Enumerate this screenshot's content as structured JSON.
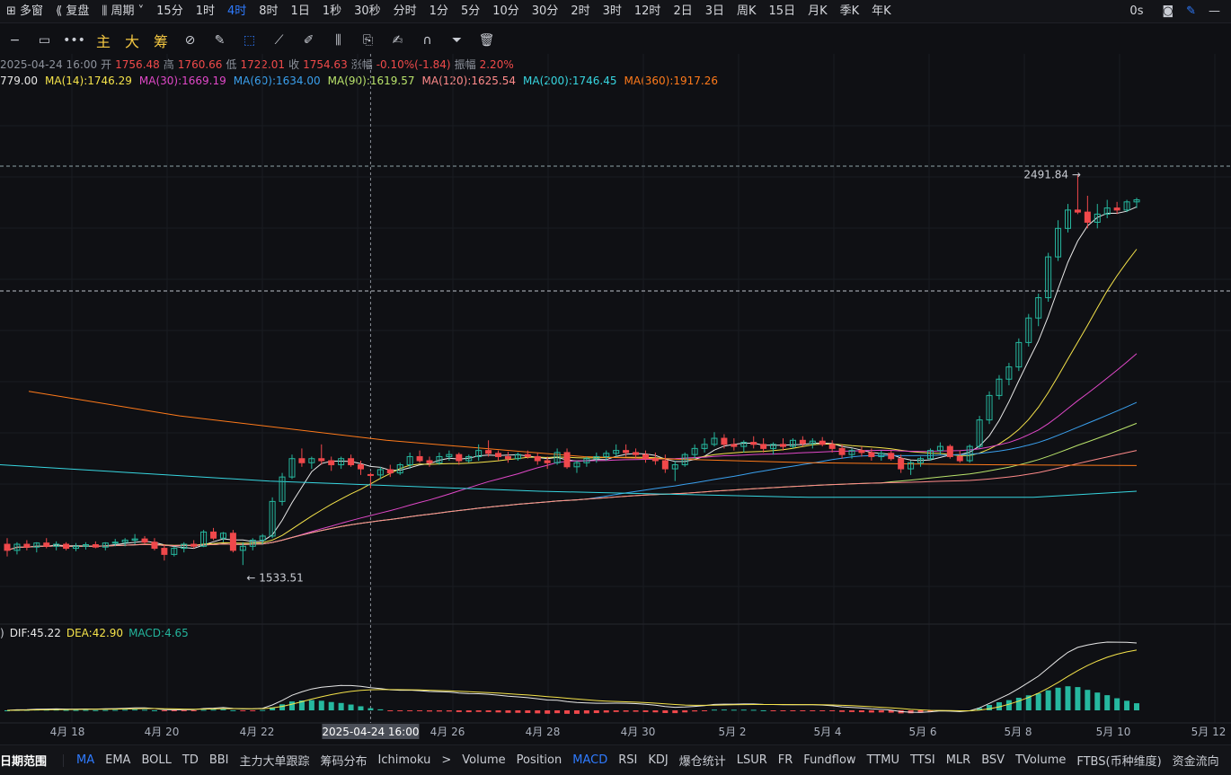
{
  "topbar": {
    "items": [
      "多窗",
      "复盘",
      "周期",
      "15分",
      "1时",
      "4时",
      "8时",
      "1日",
      "1秒",
      "30秒",
      "分时",
      "1分",
      "5分",
      "10分",
      "30分",
      "2时",
      "3时",
      "12时",
      "2日",
      "3日",
      "周K",
      "15日",
      "月K",
      "季K",
      "年K"
    ],
    "active": "4时",
    "right_label": "0s"
  },
  "toolbar": {
    "main_label": "主",
    "big_label": "大",
    "chip_label": "筹"
  },
  "ohlc": {
    "time": "2025-04-24 16:00",
    "open_label": "开",
    "open": "1756.48",
    "high_label": "高",
    "high": "1760.66",
    "low_label": "低",
    "low": "1722.01",
    "close_label": "收",
    "close": "1754.63",
    "change_label": "涨幅",
    "change": "-0.10%(-1.84)",
    "amp_label": "振幅",
    "amp": "2.20%"
  },
  "ma": [
    {
      "label": "779.00",
      "color": "#e8e8e8"
    },
    {
      "label": "MA(14):1746.29",
      "color": "#f5e34a"
    },
    {
      "label": "MA(30):1669.19",
      "color": "#e048c8"
    },
    {
      "label": "MA(60):1634.00",
      "color": "#3aa0ee"
    },
    {
      "label": "MA(90):1619.57",
      "color": "#b9e36b"
    },
    {
      "label": "MA(120):1625.54",
      "color": "#ff8a8a"
    },
    {
      "label": "MA(200):1746.45",
      "color": "#37d6e0"
    },
    {
      "label": "MA(360):1917.26",
      "color": "#ff7a1a"
    }
  ],
  "macd_info": {
    "paren": ")",
    "dif": "DIF:45.22",
    "dea": "DEA:42.90",
    "macd": "MACD:4.65"
  },
  "annotations": {
    "high_label": "2491.84 →",
    "low_label": "← 1533.51",
    "crosshair_time": "2025-04-24 16:00"
  },
  "x_axis": [
    "4月 18",
    "4月 20",
    "4月 22",
    "4月 24",
    "4月 26",
    "4月 28",
    "4月 30",
    "5月 2",
    "5月 4",
    "5月 6",
    "5月 8",
    "5月 10",
    "5月 12"
  ],
  "bottombar": {
    "range_label": "日期范围",
    "indicators": [
      "MA",
      "EMA",
      "BOLL",
      "TD",
      "BBI",
      "主力大单跟踪",
      "筹码分布",
      "Ichimoku",
      ">",
      "Volume",
      "Position",
      "MACD",
      "RSI",
      "KDJ",
      "爆仓统计",
      "LSUR",
      "FR",
      "Fundflow",
      "TTMU",
      "TTSI",
      "MLR",
      "BSV",
      "TVolume",
      "FTBS(币种维度)",
      "资金流向"
    ],
    "active": [
      "MA",
      "MACD"
    ]
  },
  "chart_data": {
    "type": "candlestick",
    "interval": "4h",
    "x_start": "2025-04-16 16:00",
    "price_range": [
      1400,
      2700
    ],
    "highest": 2491.84,
    "lowest": 1533.51,
    "colors": {
      "up": "#26b89f",
      "down": "#f0484b"
    },
    "candles": [
      [
        1585,
        1600,
        1555,
        1570
      ],
      [
        1570,
        1590,
        1560,
        1585
      ],
      [
        1585,
        1595,
        1570,
        1578
      ],
      [
        1578,
        1590,
        1565,
        1588
      ],
      [
        1588,
        1600,
        1575,
        1580
      ],
      [
        1580,
        1592,
        1570,
        1585
      ],
      [
        1585,
        1590,
        1570,
        1575
      ],
      [
        1575,
        1588,
        1568,
        1580
      ],
      [
        1580,
        1590,
        1572,
        1584
      ],
      [
        1584,
        1592,
        1575,
        1578
      ],
      [
        1578,
        1590,
        1570,
        1588
      ],
      [
        1588,
        1598,
        1580,
        1590
      ],
      [
        1590,
        1600,
        1580,
        1595
      ],
      [
        1595,
        1610,
        1585,
        1598
      ],
      [
        1598,
        1605,
        1585,
        1590
      ],
      [
        1590,
        1600,
        1570,
        1575
      ],
      [
        1575,
        1585,
        1545,
        1560
      ],
      [
        1560,
        1580,
        1555,
        1575
      ],
      [
        1575,
        1590,
        1565,
        1585
      ],
      [
        1585,
        1595,
        1575,
        1580
      ],
      [
        1580,
        1620,
        1578,
        1615
      ],
      [
        1615,
        1625,
        1595,
        1600
      ],
      [
        1600,
        1615,
        1590,
        1612
      ],
      [
        1612,
        1620,
        1565,
        1570
      ],
      [
        1570,
        1590,
        1534,
        1580
      ],
      [
        1580,
        1600,
        1570,
        1595
      ],
      [
        1595,
        1610,
        1585,
        1605
      ],
      [
        1605,
        1700,
        1600,
        1690
      ],
      [
        1690,
        1760,
        1680,
        1750
      ],
      [
        1750,
        1805,
        1745,
        1795
      ],
      [
        1795,
        1820,
        1775,
        1785
      ],
      [
        1785,
        1800,
        1770,
        1795
      ],
      [
        1795,
        1830,
        1780,
        1790
      ],
      [
        1790,
        1800,
        1765,
        1780
      ],
      [
        1780,
        1800,
        1770,
        1795
      ],
      [
        1795,
        1805,
        1775,
        1780
      ],
      [
        1780,
        1790,
        1755,
        1770
      ],
      [
        1756,
        1761,
        1722,
        1755
      ],
      [
        1755,
        1775,
        1745,
        1768
      ],
      [
        1768,
        1780,
        1750,
        1760
      ],
      [
        1760,
        1785,
        1755,
        1780
      ],
      [
        1780,
        1810,
        1770,
        1800
      ],
      [
        1800,
        1815,
        1785,
        1790
      ],
      [
        1790,
        1800,
        1775,
        1785
      ],
      [
        1785,
        1810,
        1780,
        1800
      ],
      [
        1800,
        1815,
        1790,
        1805
      ],
      [
        1805,
        1810,
        1780,
        1790
      ],
      [
        1790,
        1805,
        1785,
        1800
      ],
      [
        1800,
        1830,
        1790,
        1815
      ],
      [
        1815,
        1840,
        1800,
        1808
      ],
      [
        1808,
        1815,
        1790,
        1800
      ],
      [
        1800,
        1812,
        1785,
        1795
      ],
      [
        1795,
        1810,
        1790,
        1805
      ],
      [
        1805,
        1815,
        1795,
        1800
      ],
      [
        1800,
        1810,
        1780,
        1790
      ],
      [
        1790,
        1800,
        1770,
        1785
      ],
      [
        1785,
        1820,
        1780,
        1810
      ],
      [
        1810,
        1820,
        1770,
        1775
      ],
      [
        1775,
        1790,
        1760,
        1785
      ],
      [
        1785,
        1800,
        1775,
        1795
      ],
      [
        1795,
        1810,
        1785,
        1800
      ],
      [
        1800,
        1815,
        1790,
        1808
      ],
      [
        1808,
        1830,
        1800,
        1815
      ],
      [
        1815,
        1830,
        1800,
        1810
      ],
      [
        1810,
        1820,
        1795,
        1805
      ],
      [
        1805,
        1815,
        1785,
        1795
      ],
      [
        1795,
        1810,
        1780,
        1790
      ],
      [
        1790,
        1805,
        1760,
        1770
      ],
      [
        1770,
        1790,
        1740,
        1780
      ],
      [
        1780,
        1810,
        1775,
        1805
      ],
      [
        1805,
        1830,
        1795,
        1820
      ],
      [
        1820,
        1845,
        1810,
        1830
      ],
      [
        1830,
        1860,
        1825,
        1845
      ],
      [
        1845,
        1855,
        1820,
        1830
      ],
      [
        1830,
        1845,
        1815,
        1825
      ],
      [
        1825,
        1840,
        1810,
        1835
      ],
      [
        1835,
        1850,
        1820,
        1830
      ],
      [
        1830,
        1845,
        1810,
        1820
      ],
      [
        1820,
        1835,
        1805,
        1830
      ],
      [
        1830,
        1845,
        1815,
        1825
      ],
      [
        1825,
        1845,
        1820,
        1840
      ],
      [
        1840,
        1850,
        1825,
        1832
      ],
      [
        1832,
        1845,
        1820,
        1838
      ],
      [
        1838,
        1848,
        1825,
        1830
      ],
      [
        1830,
        1840,
        1810,
        1820
      ],
      [
        1820,
        1830,
        1795,
        1805
      ],
      [
        1805,
        1820,
        1795,
        1815
      ],
      [
        1815,
        1825,
        1800,
        1810
      ],
      [
        1810,
        1820,
        1790,
        1800
      ],
      [
        1800,
        1815,
        1790,
        1808
      ],
      [
        1808,
        1815,
        1790,
        1795
      ],
      [
        1795,
        1805,
        1760,
        1770
      ],
      [
        1770,
        1790,
        1755,
        1785
      ],
      [
        1785,
        1800,
        1775,
        1795
      ],
      [
        1795,
        1820,
        1790,
        1815
      ],
      [
        1815,
        1835,
        1805,
        1825
      ],
      [
        1825,
        1830,
        1795,
        1800
      ],
      [
        1800,
        1815,
        1785,
        1790
      ],
      [
        1790,
        1830,
        1785,
        1825
      ],
      [
        1825,
        1900,
        1820,
        1890
      ],
      [
        1890,
        1960,
        1880,
        1950
      ],
      [
        1950,
        2000,
        1940,
        1990
      ],
      [
        1990,
        2030,
        1975,
        2020
      ],
      [
        2020,
        2090,
        2010,
        2080
      ],
      [
        2080,
        2150,
        2070,
        2140
      ],
      [
        2140,
        2200,
        2120,
        2190
      ],
      [
        2190,
        2300,
        2180,
        2290
      ],
      [
        2290,
        2380,
        2280,
        2360
      ],
      [
        2360,
        2420,
        2350,
        2405
      ],
      [
        2405,
        2491.84,
        2395,
        2400
      ],
      [
        2400,
        2440,
        2360,
        2375
      ],
      [
        2375,
        2420,
        2360,
        2395
      ],
      [
        2395,
        2430,
        2385,
        2410
      ],
      [
        2410,
        2425,
        2395,
        2405
      ],
      [
        2405,
        2430,
        2400,
        2425
      ],
      [
        2425,
        2435,
        2410,
        2430
      ]
    ],
    "macd_summary": {
      "DIF": 45.22,
      "DEA": 42.9,
      "MACD": 4.65
    }
  }
}
